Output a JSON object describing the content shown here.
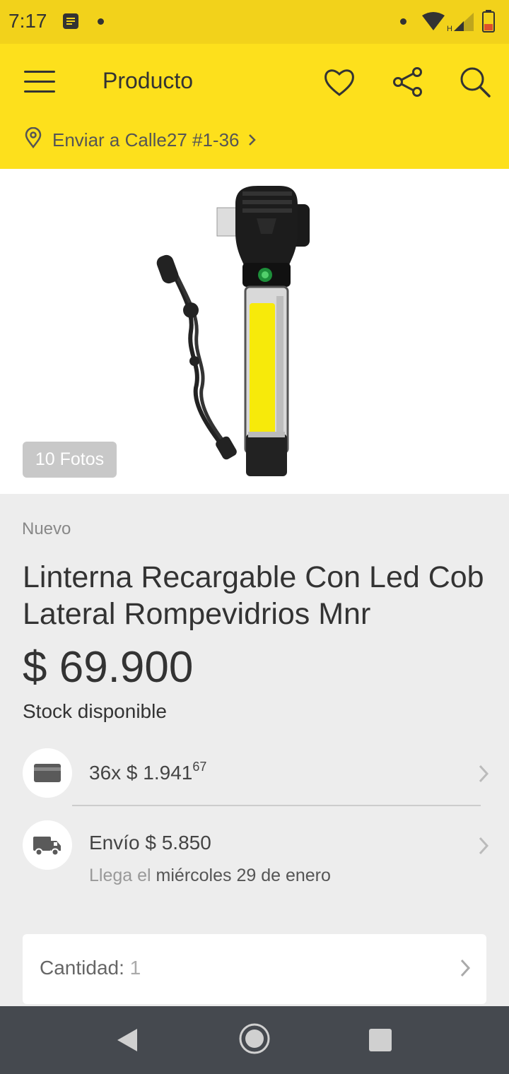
{
  "status": {
    "time": "7:17"
  },
  "appbar": {
    "title": "Producto",
    "address": "Enviar a Calle27 #1-36"
  },
  "gallery": {
    "badge": "10 Fotos"
  },
  "product": {
    "condition": "Nuevo",
    "title": "Linterna Recargable Con Led Cob Lateral Rompevidrios Mnr",
    "price": "$ 69.900",
    "stock": "Stock disponible"
  },
  "installments": {
    "text": "36x $ 1.941",
    "cents": "67"
  },
  "shipping": {
    "text": "Envío $ 5.850",
    "arrive_prefix": "Llega el",
    "arrive_date": "miércoles 29 de enero"
  },
  "quantity": {
    "label": "Cantidad:",
    "value": "1"
  },
  "colors": {
    "appbar": "#fde01c",
    "statusbar": "#f2d21b",
    "navbar": "#45494f"
  }
}
